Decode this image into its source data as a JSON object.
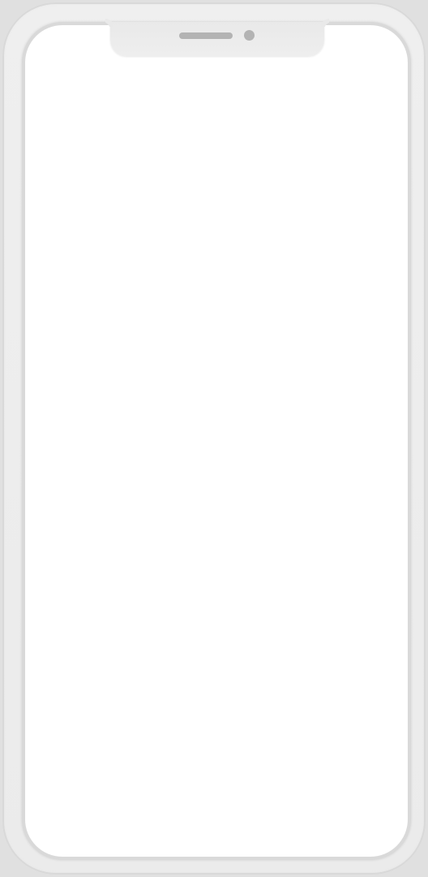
{
  "device": {
    "frame_color": "#ececec",
    "screen_color": "#ffffff",
    "notch_color": "#eaeaea",
    "sensor_color": "#b3b3b3",
    "speaker_icon": "speaker-grille-icon",
    "camera_icon": "front-camera-icon"
  }
}
